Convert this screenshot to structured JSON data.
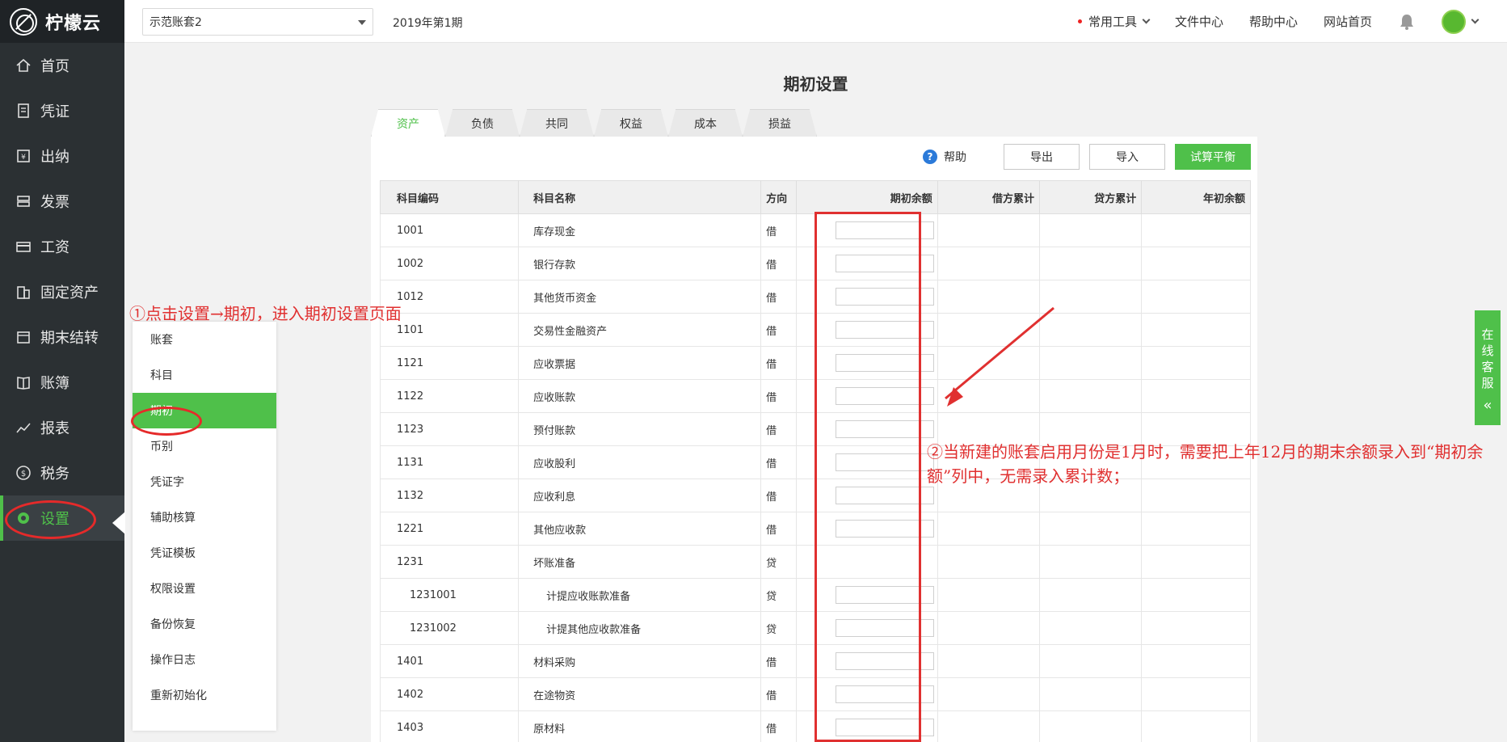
{
  "app": {
    "name": "柠檬云"
  },
  "sidebar": {
    "items": [
      {
        "label": "首页",
        "icon": "home-icon"
      },
      {
        "label": "凭证",
        "icon": "voucher-icon"
      },
      {
        "label": "出纳",
        "icon": "cashier-icon"
      },
      {
        "label": "发票",
        "icon": "invoice-icon"
      },
      {
        "label": "工资",
        "icon": "salary-icon"
      },
      {
        "label": "固定资产",
        "icon": "building-icon"
      },
      {
        "label": "期末结转",
        "icon": "calendar-icon"
      },
      {
        "label": "账簿",
        "icon": "ledger-icon"
      },
      {
        "label": "报表",
        "icon": "chart-icon"
      },
      {
        "label": "税务",
        "icon": "dollar-icon"
      },
      {
        "label": "设置",
        "icon": "gear-icon"
      }
    ]
  },
  "topbar": {
    "book": "示范账套2",
    "period": "2019年第1期",
    "links": {
      "tools": "常用工具",
      "files": "文件中心",
      "help": "帮助中心",
      "site": "网站首页"
    }
  },
  "page": {
    "title": "期初设置"
  },
  "tabs": [
    "资产",
    "负债",
    "共同",
    "权益",
    "成本",
    "损益"
  ],
  "toolbar": {
    "help": "帮助",
    "export": "导出",
    "import": "导入",
    "trial": "试算平衡"
  },
  "table": {
    "headers": [
      "科目编码",
      "科目名称",
      "方向",
      "期初余额",
      "借方累计",
      "贷方累计",
      "年初余额"
    ],
    "rows": [
      {
        "code": "1001",
        "name": "库存现金",
        "dir": "借",
        "input": true
      },
      {
        "code": "1002",
        "name": "银行存款",
        "dir": "借",
        "input": true
      },
      {
        "code": "1012",
        "name": "其他货币资金",
        "dir": "借",
        "input": true
      },
      {
        "code": "1101",
        "name": "交易性金融资产",
        "dir": "借",
        "input": true
      },
      {
        "code": "1121",
        "name": "应收票据",
        "dir": "借",
        "input": true
      },
      {
        "code": "1122",
        "name": "应收账款",
        "dir": "借",
        "input": true
      },
      {
        "code": "1123",
        "name": "预付账款",
        "dir": "借",
        "input": true
      },
      {
        "code": "1131",
        "name": "应收股利",
        "dir": "借",
        "input": true
      },
      {
        "code": "1132",
        "name": "应收利息",
        "dir": "借",
        "input": true
      },
      {
        "code": "1221",
        "name": "其他应收款",
        "dir": "借",
        "input": true
      },
      {
        "code": "1231",
        "name": "坏账准备",
        "dir": "贷",
        "input": false
      },
      {
        "code": "1231001",
        "name": "计提应收账款准备",
        "dir": "贷",
        "input": true,
        "sub": true
      },
      {
        "code": "1231002",
        "name": "计提其他应收款准备",
        "dir": "贷",
        "input": true,
        "sub": true
      },
      {
        "code": "1401",
        "name": "材料采购",
        "dir": "借",
        "input": true
      },
      {
        "code": "1402",
        "name": "在途物资",
        "dir": "借",
        "input": true
      },
      {
        "code": "1403",
        "name": "原材料",
        "dir": "借",
        "input": true
      }
    ]
  },
  "submenu": [
    "账套",
    "科目",
    "期初",
    "币别",
    "凭证字",
    "辅助核算",
    "凭证模板",
    "权限设置",
    "备份恢复",
    "操作日志",
    "重新初始化"
  ],
  "annotations": {
    "step1": "①点击设置→期初，进入期初设置页面",
    "step2": "②当新建的账套启用月份是1月时，需要把上年12月的期末余额录入到“期初余额”列中，无需录入累计数；"
  },
  "service": {
    "label": "在线客服"
  },
  "colors": {
    "accent": "#4fc04a",
    "sidebar": "#2b3033",
    "annotation": "#e03030"
  }
}
